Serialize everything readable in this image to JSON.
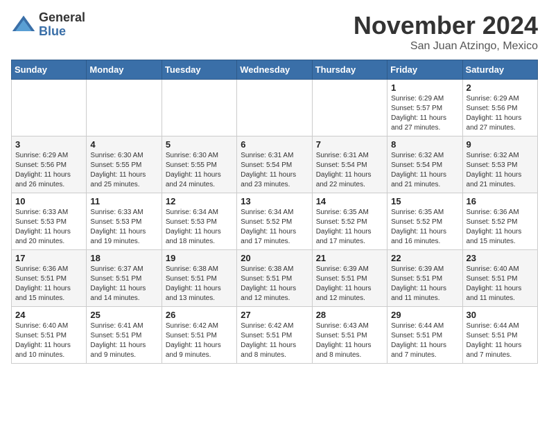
{
  "header": {
    "logo_general": "General",
    "logo_blue": "Blue",
    "month_title": "November 2024",
    "location": "San Juan Atzingo, Mexico"
  },
  "calendar": {
    "days_of_week": [
      "Sunday",
      "Monday",
      "Tuesday",
      "Wednesday",
      "Thursday",
      "Friday",
      "Saturday"
    ],
    "weeks": [
      [
        {
          "day": "",
          "info": ""
        },
        {
          "day": "",
          "info": ""
        },
        {
          "day": "",
          "info": ""
        },
        {
          "day": "",
          "info": ""
        },
        {
          "day": "",
          "info": ""
        },
        {
          "day": "1",
          "info": "Sunrise: 6:29 AM\nSunset: 5:57 PM\nDaylight: 11 hours and 27 minutes."
        },
        {
          "day": "2",
          "info": "Sunrise: 6:29 AM\nSunset: 5:56 PM\nDaylight: 11 hours and 27 minutes."
        }
      ],
      [
        {
          "day": "3",
          "info": "Sunrise: 6:29 AM\nSunset: 5:56 PM\nDaylight: 11 hours and 26 minutes."
        },
        {
          "day": "4",
          "info": "Sunrise: 6:30 AM\nSunset: 5:55 PM\nDaylight: 11 hours and 25 minutes."
        },
        {
          "day": "5",
          "info": "Sunrise: 6:30 AM\nSunset: 5:55 PM\nDaylight: 11 hours and 24 minutes."
        },
        {
          "day": "6",
          "info": "Sunrise: 6:31 AM\nSunset: 5:54 PM\nDaylight: 11 hours and 23 minutes."
        },
        {
          "day": "7",
          "info": "Sunrise: 6:31 AM\nSunset: 5:54 PM\nDaylight: 11 hours and 22 minutes."
        },
        {
          "day": "8",
          "info": "Sunrise: 6:32 AM\nSunset: 5:54 PM\nDaylight: 11 hours and 21 minutes."
        },
        {
          "day": "9",
          "info": "Sunrise: 6:32 AM\nSunset: 5:53 PM\nDaylight: 11 hours and 21 minutes."
        }
      ],
      [
        {
          "day": "10",
          "info": "Sunrise: 6:33 AM\nSunset: 5:53 PM\nDaylight: 11 hours and 20 minutes."
        },
        {
          "day": "11",
          "info": "Sunrise: 6:33 AM\nSunset: 5:53 PM\nDaylight: 11 hours and 19 minutes."
        },
        {
          "day": "12",
          "info": "Sunrise: 6:34 AM\nSunset: 5:53 PM\nDaylight: 11 hours and 18 minutes."
        },
        {
          "day": "13",
          "info": "Sunrise: 6:34 AM\nSunset: 5:52 PM\nDaylight: 11 hours and 17 minutes."
        },
        {
          "day": "14",
          "info": "Sunrise: 6:35 AM\nSunset: 5:52 PM\nDaylight: 11 hours and 17 minutes."
        },
        {
          "day": "15",
          "info": "Sunrise: 6:35 AM\nSunset: 5:52 PM\nDaylight: 11 hours and 16 minutes."
        },
        {
          "day": "16",
          "info": "Sunrise: 6:36 AM\nSunset: 5:52 PM\nDaylight: 11 hours and 15 minutes."
        }
      ],
      [
        {
          "day": "17",
          "info": "Sunrise: 6:36 AM\nSunset: 5:51 PM\nDaylight: 11 hours and 15 minutes."
        },
        {
          "day": "18",
          "info": "Sunrise: 6:37 AM\nSunset: 5:51 PM\nDaylight: 11 hours and 14 minutes."
        },
        {
          "day": "19",
          "info": "Sunrise: 6:38 AM\nSunset: 5:51 PM\nDaylight: 11 hours and 13 minutes."
        },
        {
          "day": "20",
          "info": "Sunrise: 6:38 AM\nSunset: 5:51 PM\nDaylight: 11 hours and 12 minutes."
        },
        {
          "day": "21",
          "info": "Sunrise: 6:39 AM\nSunset: 5:51 PM\nDaylight: 11 hours and 12 minutes."
        },
        {
          "day": "22",
          "info": "Sunrise: 6:39 AM\nSunset: 5:51 PM\nDaylight: 11 hours and 11 minutes."
        },
        {
          "day": "23",
          "info": "Sunrise: 6:40 AM\nSunset: 5:51 PM\nDaylight: 11 hours and 11 minutes."
        }
      ],
      [
        {
          "day": "24",
          "info": "Sunrise: 6:40 AM\nSunset: 5:51 PM\nDaylight: 11 hours and 10 minutes."
        },
        {
          "day": "25",
          "info": "Sunrise: 6:41 AM\nSunset: 5:51 PM\nDaylight: 11 hours and 9 minutes."
        },
        {
          "day": "26",
          "info": "Sunrise: 6:42 AM\nSunset: 5:51 PM\nDaylight: 11 hours and 9 minutes."
        },
        {
          "day": "27",
          "info": "Sunrise: 6:42 AM\nSunset: 5:51 PM\nDaylight: 11 hours and 8 minutes."
        },
        {
          "day": "28",
          "info": "Sunrise: 6:43 AM\nSunset: 5:51 PM\nDaylight: 11 hours and 8 minutes."
        },
        {
          "day": "29",
          "info": "Sunrise: 6:44 AM\nSunset: 5:51 PM\nDaylight: 11 hours and 7 minutes."
        },
        {
          "day": "30",
          "info": "Sunrise: 6:44 AM\nSunset: 5:51 PM\nDaylight: 11 hours and 7 minutes."
        }
      ]
    ]
  }
}
